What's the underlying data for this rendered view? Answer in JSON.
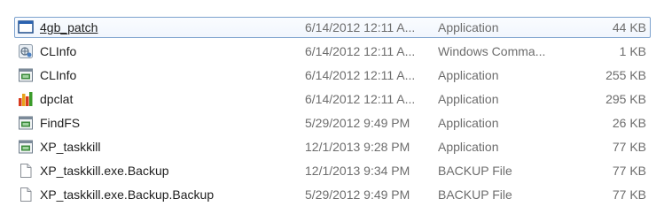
{
  "files": [
    {
      "name": "4gb_patch",
      "date": "6/14/2012 12:11 A...",
      "type": "Application",
      "size": "44 KB",
      "icon": "window-app-icon",
      "selected": true
    },
    {
      "name": "CLInfo",
      "date": "6/14/2012 12:11 A...",
      "type": "Windows Comma...",
      "size": "1 KB",
      "icon": "script-file-icon",
      "selected": false
    },
    {
      "name": "CLInfo",
      "date": "6/14/2012 12:11 A...",
      "type": "Application",
      "size": "255 KB",
      "icon": "exe-app-icon",
      "selected": false
    },
    {
      "name": "dpclat",
      "date": "6/14/2012 12:11 A...",
      "type": "Application",
      "size": "295 KB",
      "icon": "bar-chart-icon",
      "selected": false
    },
    {
      "name": "FindFS",
      "date": "5/29/2012 9:49 PM",
      "type": "Application",
      "size": "26 KB",
      "icon": "exe-app-icon",
      "selected": false
    },
    {
      "name": "XP_taskkill",
      "date": "12/1/2013 9:28 PM",
      "type": "Application",
      "size": "77 KB",
      "icon": "exe-app-icon",
      "selected": false
    },
    {
      "name": "XP_taskkill.exe.Backup",
      "date": "12/1/2013 9:34 PM",
      "type": "BACKUP File",
      "size": "77 KB",
      "icon": "blank-file-icon",
      "selected": false
    },
    {
      "name": "XP_taskkill.exe.Backup.Backup",
      "date": "5/29/2012 9:49 PM",
      "type": "BACKUP File",
      "size": "77 KB",
      "icon": "blank-file-icon",
      "selected": false
    }
  ],
  "colors": {
    "selection_border": "#7da2ce",
    "secondary_text": "#6d6d6d",
    "primary_text": "#1e1e1e"
  }
}
